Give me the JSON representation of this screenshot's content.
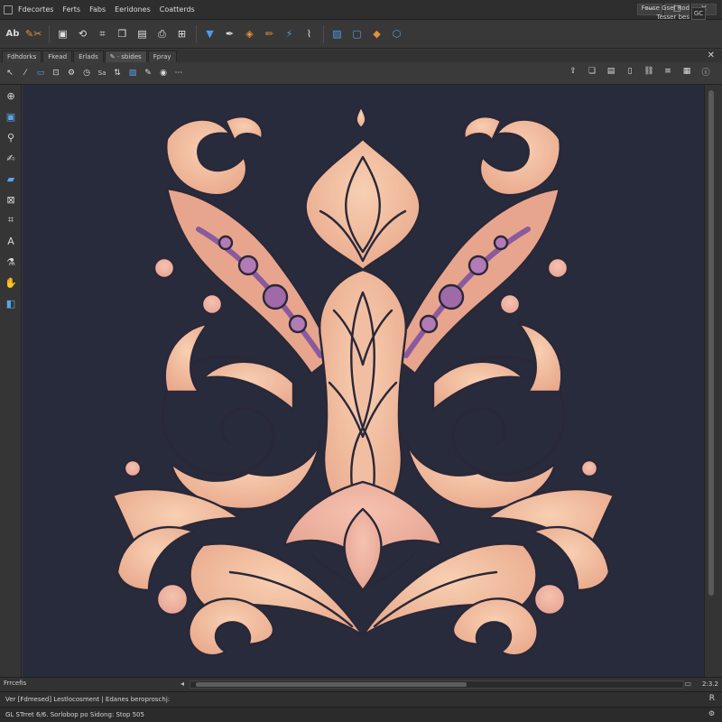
{
  "menubar": {
    "items": [
      "Fdecortes",
      "Ferts",
      "Fabs",
      "Eeridones",
      "Coatterds"
    ],
    "window_controls": [
      "—",
      "□",
      "✕"
    ]
  },
  "toolbar": {
    "tools": [
      {
        "icon": "text-tool-icon",
        "glyph": "Ab",
        "kind": "text"
      },
      {
        "icon": "brush-set-icon",
        "glyph": "✎✂",
        "kind": "orange"
      },
      {
        "icon": "frame-icon",
        "glyph": "▣",
        "kind": ""
      },
      {
        "icon": "transform-icon",
        "glyph": "⟲",
        "kind": ""
      },
      {
        "icon": "crop-icon",
        "glyph": "⌗",
        "kind": ""
      },
      {
        "icon": "layers-icon",
        "glyph": "❐",
        "kind": ""
      },
      {
        "icon": "save-icon",
        "glyph": "▤",
        "kind": ""
      },
      {
        "icon": "print-icon",
        "glyph": "⎙",
        "kind": ""
      },
      {
        "icon": "grid-icon",
        "glyph": "⊞",
        "kind": ""
      },
      {
        "icon": "filter-icon",
        "glyph": "▼",
        "kind": "blue"
      },
      {
        "icon": "pen-icon",
        "glyph": "✒",
        "kind": ""
      },
      {
        "icon": "palette-icon",
        "glyph": "◈",
        "kind": "orange"
      },
      {
        "icon": "pencil-icon",
        "glyph": "✏",
        "kind": "orange"
      },
      {
        "icon": "magic-wand-icon",
        "glyph": "⚡",
        "kind": "blue"
      },
      {
        "icon": "lasso-icon",
        "glyph": "⌇",
        "kind": ""
      },
      {
        "icon": "image-icon",
        "glyph": "▨",
        "kind": "blue"
      },
      {
        "icon": "monitor-icon",
        "glyph": "▢",
        "kind": "blue"
      },
      {
        "icon": "color-picker-icon",
        "glyph": "◆",
        "kind": "orange"
      },
      {
        "icon": "cube-icon",
        "glyph": "⬡",
        "kind": "blue"
      }
    ],
    "right_line1": "Feuse Gsel Rod",
    "right_line2": "Tesser bes",
    "badge": "GC"
  },
  "tabs": {
    "items": [
      "Fdhdorks",
      "Fkead",
      "Erlads",
      "✎ · sbides",
      "Fpray"
    ],
    "active_index": 3,
    "close_glyph": "✕"
  },
  "optionsbar": {
    "items": [
      {
        "icon": "pointer-icon",
        "glyph": "↖",
        "kind": ""
      },
      {
        "icon": "brush-icon",
        "glyph": "⁄",
        "kind": ""
      },
      {
        "icon": "rect-select-icon",
        "glyph": "▭",
        "kind": "blue"
      },
      {
        "icon": "mode-icon",
        "glyph": "⊡",
        "kind": ""
      },
      {
        "icon": "settings-icon",
        "glyph": "⚙",
        "kind": ""
      },
      {
        "icon": "timer-icon",
        "glyph": "◷",
        "kind": ""
      },
      {
        "icon": "swatch-icon",
        "glyph": "Sa",
        "kind": "label"
      },
      {
        "icon": "adjust-icon",
        "glyph": "⇅",
        "kind": ""
      },
      {
        "icon": "image-mode-icon",
        "glyph": "▨",
        "kind": "blue"
      },
      {
        "icon": "paint-icon",
        "glyph": "✎",
        "kind": ""
      },
      {
        "icon": "globe-icon",
        "glyph": "◉",
        "kind": ""
      },
      {
        "icon": "more-icon",
        "glyph": "⋯",
        "kind": ""
      }
    ],
    "right_items": [
      {
        "icon": "export-icon",
        "glyph": "⇪"
      },
      {
        "icon": "copy-icon",
        "glyph": "❏"
      },
      {
        "icon": "doc-icon",
        "glyph": "▤"
      },
      {
        "icon": "blank-icon",
        "glyph": "▯"
      },
      {
        "icon": "link-icon",
        "glyph": "⛓"
      },
      {
        "icon": "list-icon",
        "glyph": "≡"
      },
      {
        "icon": "stack-icon",
        "glyph": "▦"
      },
      {
        "icon": "info-icon",
        "glyph": "ⓘ"
      }
    ]
  },
  "leftpanel": {
    "tools": [
      {
        "icon": "move-tool-icon",
        "glyph": "⊕",
        "kind": ""
      },
      {
        "icon": "frame-tool-icon",
        "glyph": "▣",
        "kind": "blue"
      },
      {
        "icon": "zoom-tool-icon",
        "glyph": "⚲",
        "kind": ""
      },
      {
        "icon": "brush-tool-icon",
        "glyph": "✍",
        "kind": ""
      },
      {
        "icon": "shape-tool-icon",
        "glyph": "▰",
        "kind": "blue"
      },
      {
        "icon": "stamp-tool-icon",
        "glyph": "⊠",
        "kind": ""
      },
      {
        "icon": "crop-tool-icon",
        "glyph": "⌗",
        "kind": ""
      },
      {
        "icon": "text-tool-icon",
        "glyph": "A",
        "kind": ""
      },
      {
        "icon": "eyedropper-tool-icon",
        "glyph": "⚗",
        "kind": ""
      },
      {
        "icon": "hand-tool-icon",
        "glyph": "✋",
        "kind": ""
      },
      {
        "icon": "color-swap-icon",
        "glyph": "◧",
        "kind": "blue"
      }
    ]
  },
  "bottom": {
    "panel_label": "Frrcefis",
    "zoom": "2:3.2",
    "status_line1": "Ver [Fdmesed] Lestlocosment | Edanes beroproschj:",
    "status_line2": "GL STrret 6/6. Sorlobop po Sidong: Stop 505",
    "status_icon1": "R",
    "status_icon2": "⚙"
  },
  "colors": {
    "canvas_bg": "#272b3b",
    "ornament_fill": "#f0b898",
    "ornament_stroke": "#2a2838",
    "accent_purple": "#8a5a9e"
  }
}
